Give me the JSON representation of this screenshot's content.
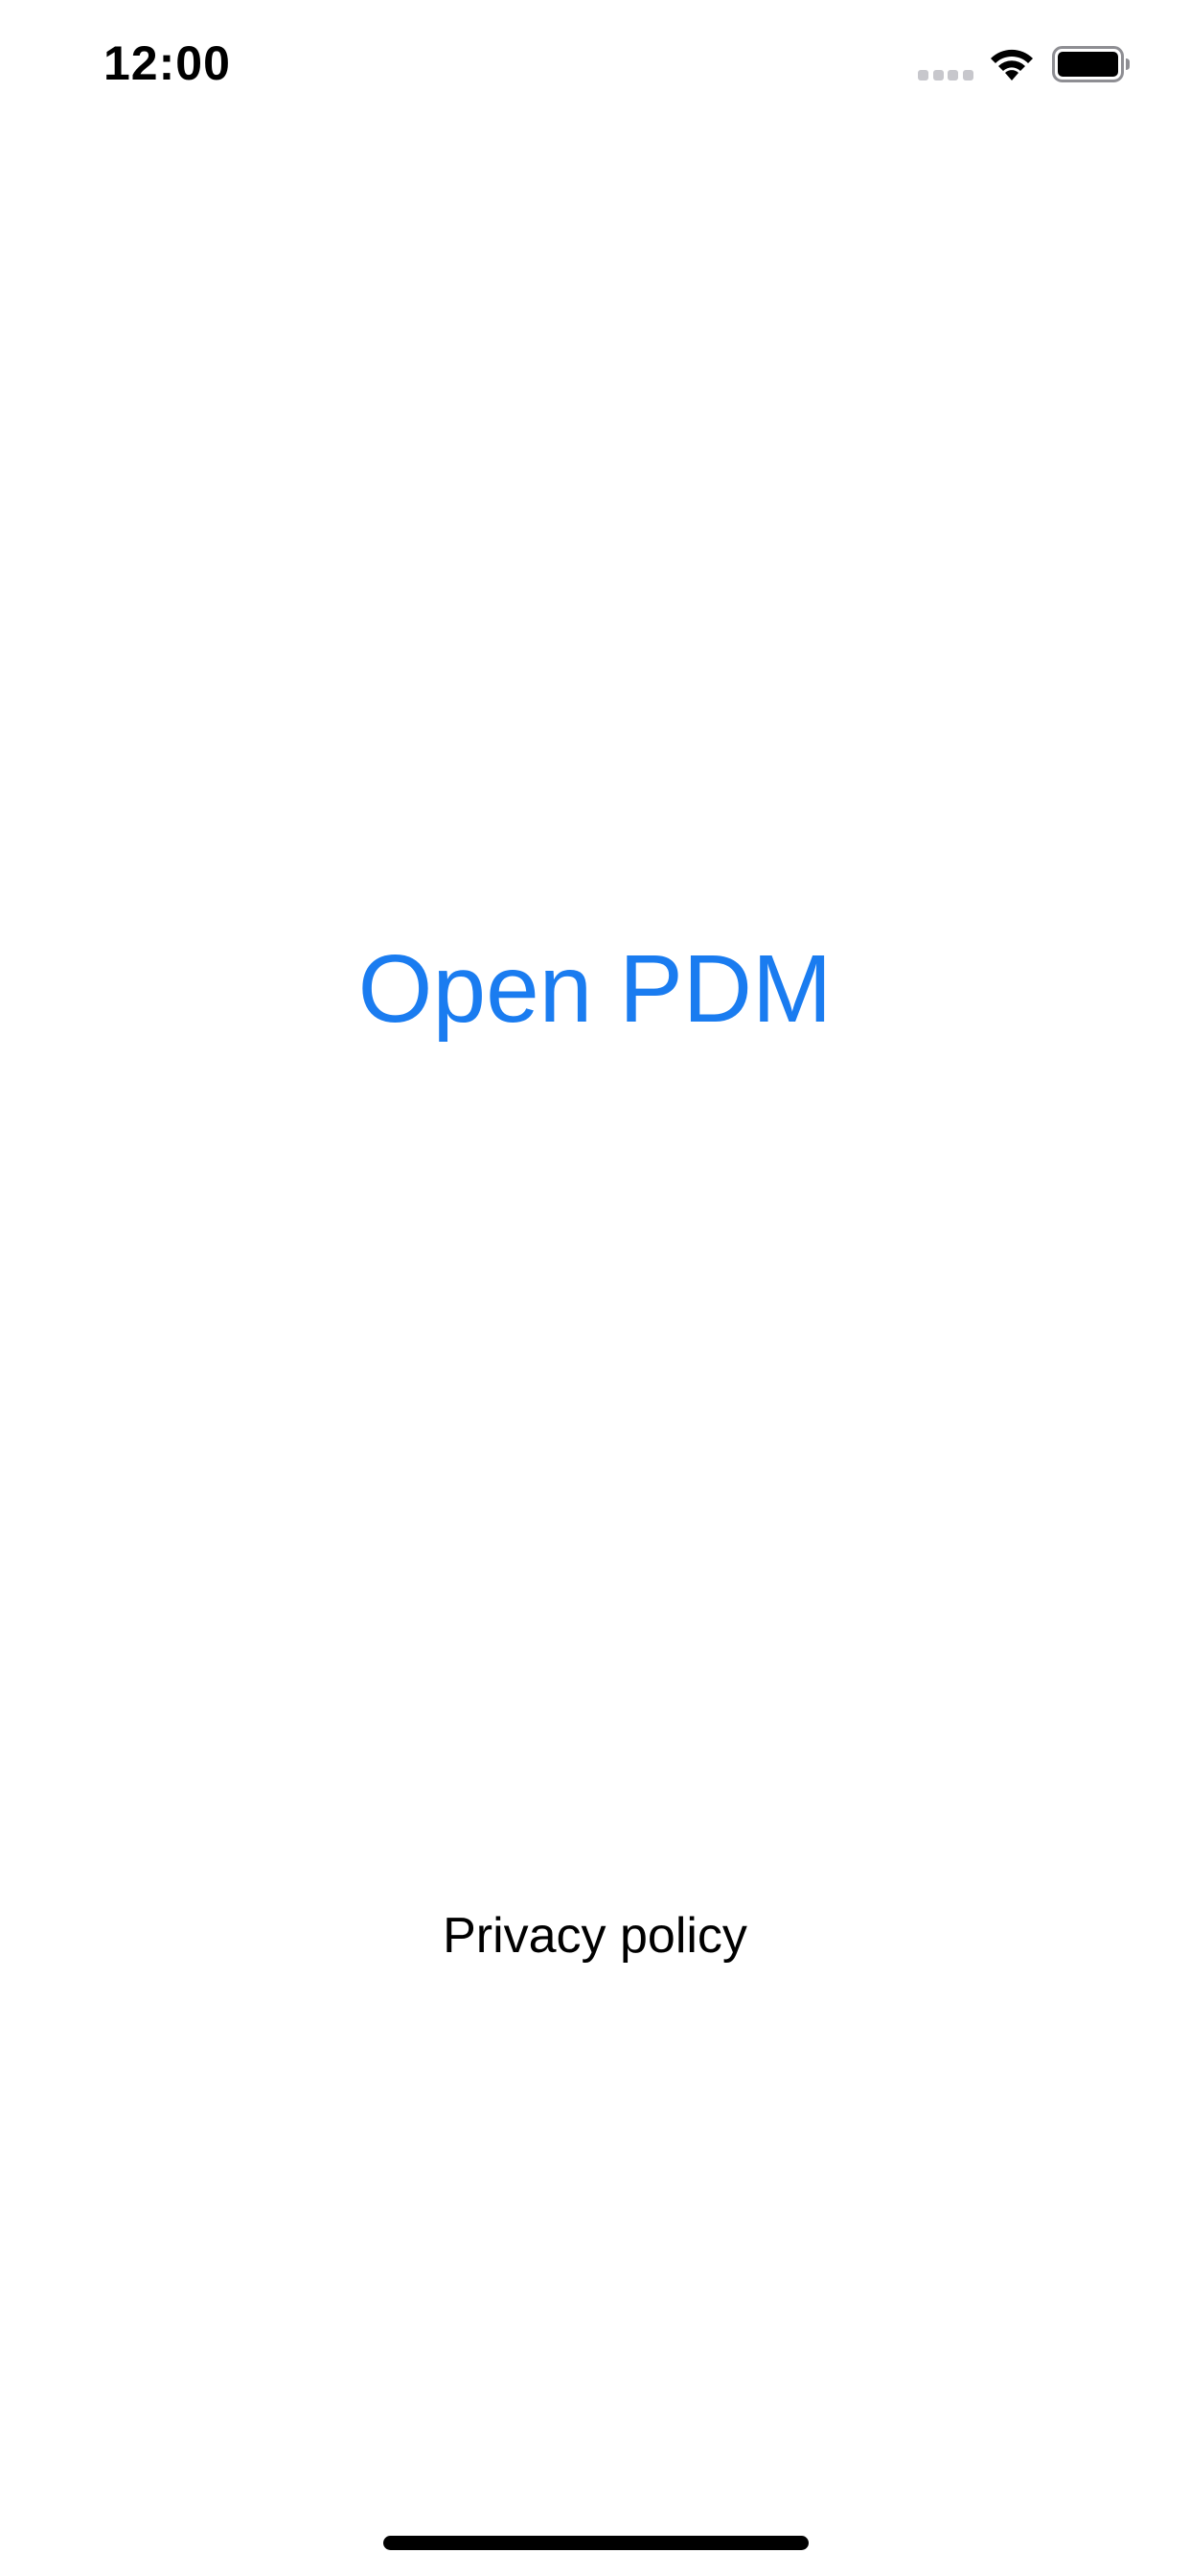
{
  "status_bar": {
    "time": "12:00",
    "icons": [
      "cellular-signal-icon",
      "wifi-icon",
      "battery-icon"
    ]
  },
  "main": {
    "open_button_label": "Open PDM",
    "privacy_link_label": "Privacy policy"
  },
  "colors": {
    "accent": "#1a7cf0",
    "text": "#000000",
    "background": "#ffffff",
    "inactive_signal": "#c7c7cc"
  }
}
